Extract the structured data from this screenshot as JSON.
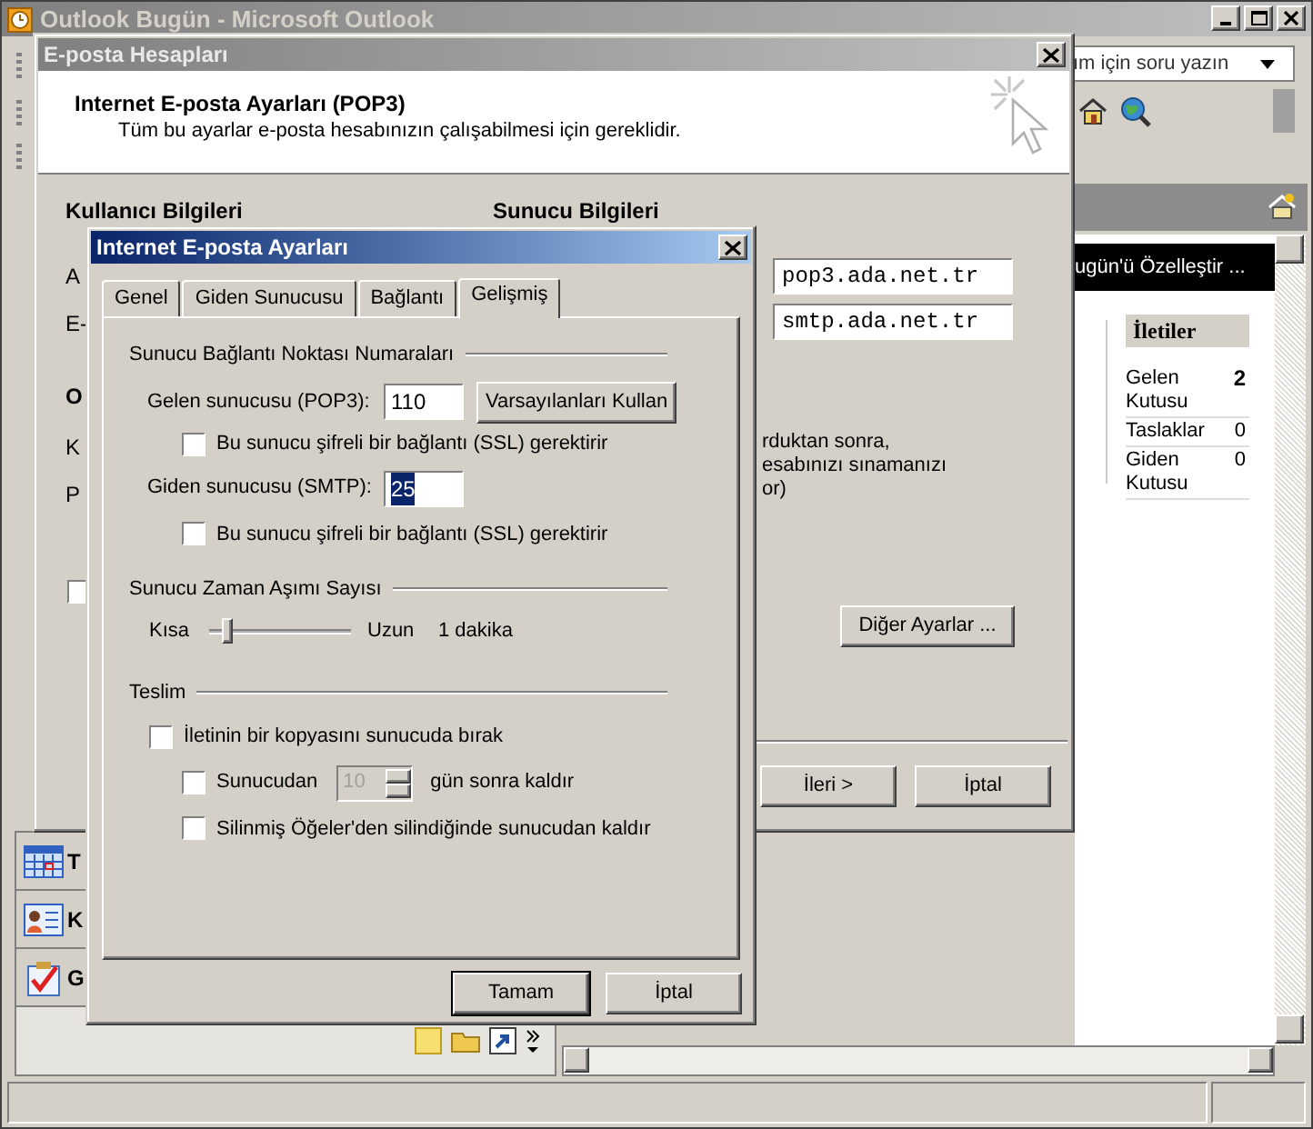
{
  "main_window": {
    "title": "Outlook Bugün - Microsoft Outlook",
    "help_box": {
      "placeholder": "ım için soru yazın"
    },
    "customize_bar": "ugün'ü Özelleştir ...",
    "messages": {
      "header": "İletiler",
      "rows": [
        {
          "name": "Gelen Kutusu",
          "count": "2",
          "unread": true
        },
        {
          "name": "Taslaklar",
          "count": "0",
          "unread": false
        },
        {
          "name": "Giden Kutusu",
          "count": "0",
          "unread": false
        }
      ]
    },
    "nav_buttons": [
      {
        "kind": "calendar",
        "label": "T"
      },
      {
        "kind": "contacts",
        "label": "K"
      },
      {
        "kind": "tasks",
        "label": "G"
      }
    ]
  },
  "accounts_dialog": {
    "title": "E-posta Hesapları",
    "heading": "Internet E-posta Ayarları (POP3)",
    "subheading": "Tüm bu ayarlar e-posta hesabınızın çalışabilmesi için gereklidir.",
    "user_section": "Kullanıcı Bilgileri",
    "server_section": "Sunucu Bilgileri",
    "left_fragments": [
      {
        "text": "A",
        "bold": false
      },
      {
        "text": "E-",
        "bold": false
      },
      {
        "text": "O",
        "bold": true
      },
      {
        "text": "K",
        "bold": false
      },
      {
        "text": "P",
        "bold": false
      }
    ],
    "left_checkbox": {
      "checked": false
    },
    "incoming_server": "pop3.ada.net.tr",
    "outgoing_server": "smtp.ada.net.tr",
    "right_fragments": [
      "rduktan sonra,",
      "esabınızı sınamanızı",
      "or)"
    ],
    "more_settings_button": "Diğer Ayarlar ...",
    "buttons": [
      "İleri >",
      "İptal"
    ]
  },
  "settings_dialog": {
    "title": "Internet E-posta Ayarları",
    "tabs": [
      {
        "label": "Genel",
        "selected": false
      },
      {
        "label": "Giden Sunucusu",
        "selected": false
      },
      {
        "label": "Bağlantı",
        "selected": false
      },
      {
        "label": "Gelişmiş",
        "selected": true
      }
    ],
    "ports_group": "Sunucu Bağlantı Noktası Numaraları",
    "incoming_label": "Gelen sunucusu (POP3):",
    "incoming_port": "110",
    "defaults_button": "Varsayılanları Kullan",
    "incoming_ssl": {
      "label": "Bu sunucu şifreli bir bağlantı (SSL) gerektirir",
      "checked": false
    },
    "outgoing_label": "Giden sunucusu (SMTP):",
    "outgoing_port": {
      "value": "25",
      "selected": true
    },
    "outgoing_ssl": {
      "label": "Bu sunucu şifreli bir bağlantı (SSL) gerektirir",
      "checked": false
    },
    "timeout_group": "Sunucu Zaman Aşımı Sayısı",
    "timeout": {
      "min_label": "Kısa",
      "max_label": "Uzun",
      "level": 0.1,
      "reading": "1 dakika"
    },
    "delivery_group": "Teslim",
    "leave_copy": {
      "label": "İletinin bir kopyasını sunucuda bırak",
      "checked": false
    },
    "remove_after": {
      "label": "Sunucudan",
      "checked": false,
      "days": "10",
      "suffix": "gün sonra kaldır",
      "disabled": true
    },
    "remove_deleted": {
      "label": "Silinmiş Öğeler'den silindiğinde sunucudan kaldır",
      "checked": false
    },
    "buttons": [
      {
        "label": "Tamam",
        "default": true
      },
      {
        "label": "İptal",
        "default": false
      }
    ]
  }
}
